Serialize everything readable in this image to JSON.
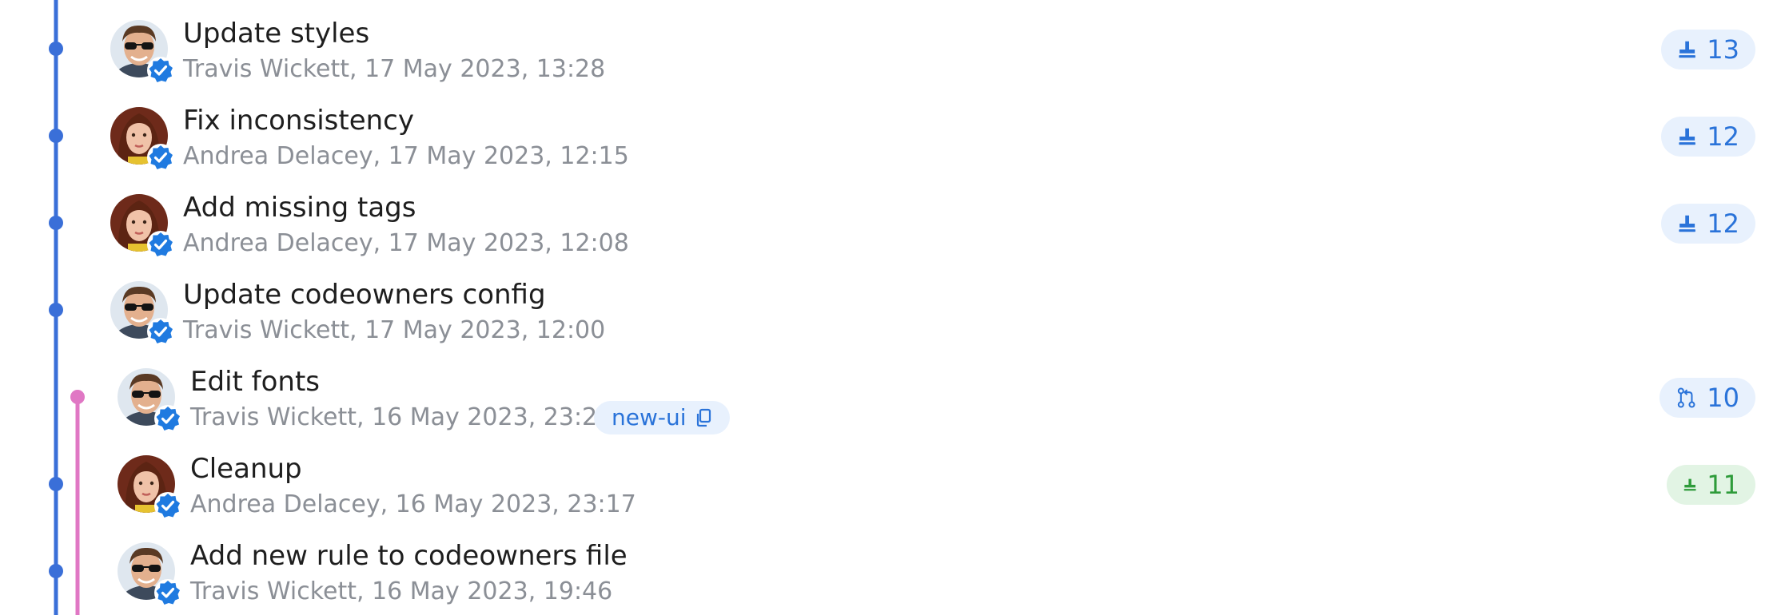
{
  "colors": {
    "main_branch": "#3a6fd8",
    "side_branch": "#e077c4",
    "badge_blue_bg": "#e8f1fd",
    "badge_blue_fg": "#2a73d9",
    "badge_green_bg": "#e2f4e4",
    "badge_green_fg": "#2e9b3a",
    "verified": "#1f7ae0"
  },
  "commits": [
    {
      "title": "Update styles",
      "meta": "Travis Wickett, 17 May 2023, 13:28",
      "avatar": "travis",
      "badge": {
        "icon": "stamp-icon",
        "value": "13",
        "style": "blue"
      }
    },
    {
      "title": "Fix inconsistency",
      "meta": "Andrea Delacey, 17 May 2023, 12:15",
      "avatar": "andrea",
      "badge": {
        "icon": "stamp-icon",
        "value": "12",
        "style": "blue"
      }
    },
    {
      "title": "Add missing tags",
      "meta": "Andrea Delacey, 17 May 2023, 12:08",
      "avatar": "andrea",
      "badge": {
        "icon": "stamp-icon",
        "value": "12",
        "style": "blue"
      }
    },
    {
      "title": "Update codeowners config",
      "meta": "Travis Wickett, 17 May 2023, 12:00",
      "avatar": "travis"
    },
    {
      "title": "Edit fonts",
      "meta": "Travis Wickett, 16 May 2023, 23:22",
      "avatar": "travis",
      "branch": "new-ui",
      "badge": {
        "icon": "pull-request-icon",
        "value": "10",
        "style": "blue"
      }
    },
    {
      "title": "Cleanup",
      "meta": "Andrea Delacey, 16 May 2023, 23:17",
      "avatar": "andrea",
      "badge": {
        "icon": "stamp-icon",
        "value": "11",
        "style": "green"
      }
    },
    {
      "title": "Add new rule to codeowners file",
      "meta": "Travis Wickett, 16 May 2023, 19:46",
      "avatar": "travis"
    }
  ]
}
